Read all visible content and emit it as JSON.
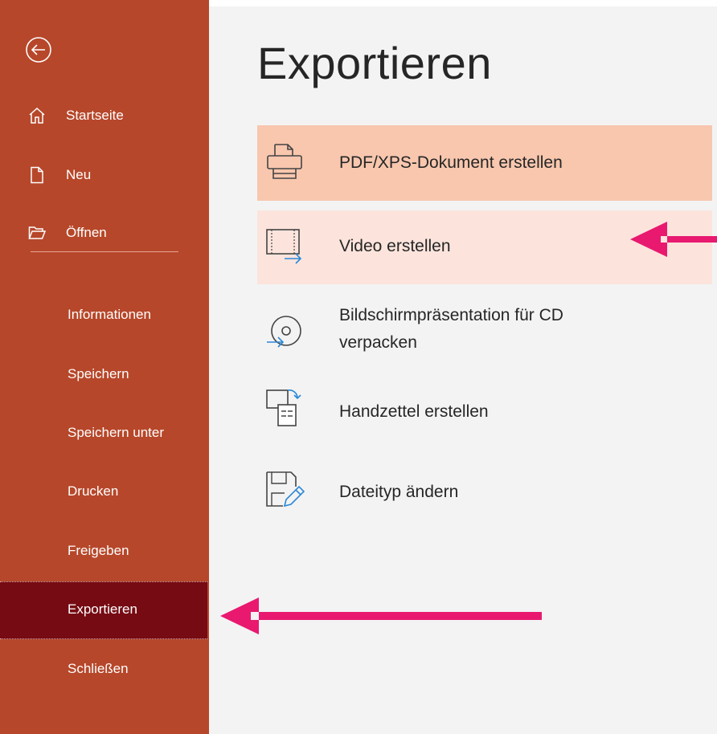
{
  "sidebar": {
    "items_top": [
      {
        "label": "Startseite",
        "icon": "home-icon"
      },
      {
        "label": "Neu",
        "icon": "new-document-icon"
      },
      {
        "label": "Öffnen",
        "icon": "open-folder-icon"
      }
    ],
    "items": [
      {
        "label": "Informationen"
      },
      {
        "label": "Speichern"
      },
      {
        "label": "Speichern unter"
      },
      {
        "label": "Drucken"
      },
      {
        "label": "Freigeben"
      },
      {
        "label": "Exportieren",
        "active": true
      },
      {
        "label": "Schließen"
      }
    ]
  },
  "main": {
    "title": "Exportieren",
    "options": [
      {
        "label": "PDF/XPS-Dokument erstellen",
        "icon": "pdf-document-icon",
        "state": "selected"
      },
      {
        "label": "Video erstellen",
        "icon": "video-icon",
        "state": "hover"
      },
      {
        "label_line1": "Bildschirmpräsentation für CD",
        "label_line2": "verpacken",
        "icon": "cd-package-icon"
      },
      {
        "label": "Handzettel erstellen",
        "icon": "handout-icon"
      },
      {
        "label": "Dateityp ändern",
        "icon": "change-filetype-icon"
      }
    ]
  },
  "colors": {
    "sidebar": "#b7472a",
    "sidebar_active": "#760b13",
    "selected_option": "#f8c7ae",
    "hover_option": "#fce4dc",
    "annotation_arrow": "#e8196f"
  }
}
